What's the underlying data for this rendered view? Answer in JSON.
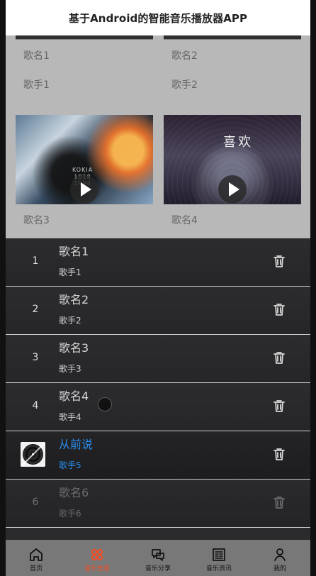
{
  "header": {
    "title": "基于Android的智能音乐播放器APP"
  },
  "grid": {
    "top_cards": [
      {
        "song": "歌名1",
        "singer": "歌手1"
      },
      {
        "song": "歌名2",
        "singer": "歌手2"
      }
    ],
    "bottom_cards": [
      {
        "song": "歌名3",
        "cover_text_lines": [
          "KOKIA",
          "1018",
          "1998"
        ]
      },
      {
        "song": "歌名4",
        "cover_text": "喜欢"
      }
    ]
  },
  "playlist": [
    {
      "index": "1",
      "title": "歌名1",
      "subtitle": "歌手1",
      "state": "normal"
    },
    {
      "index": "2",
      "title": "歌名2",
      "subtitle": "歌手2",
      "state": "normal"
    },
    {
      "index": "3",
      "title": "歌名3",
      "subtitle": "歌手3",
      "state": "normal"
    },
    {
      "index": "4",
      "title": "歌名4",
      "subtitle": "歌手4",
      "state": "normal"
    },
    {
      "index": "",
      "title": "从前说",
      "subtitle": "歌手5",
      "state": "active"
    },
    {
      "index": "6",
      "title": "歌名6",
      "subtitle": "歌手6",
      "state": "faded"
    }
  ],
  "bottom_nav": [
    {
      "label": "首页",
      "icon": "home-icon",
      "active": false
    },
    {
      "label": "音乐信息",
      "icon": "music-info-icon",
      "active": true
    },
    {
      "label": "音乐分享",
      "icon": "chat-bubbles-icon",
      "active": false
    },
    {
      "label": "音乐资讯",
      "icon": "news-icon",
      "active": false
    },
    {
      "label": "我的",
      "icon": "user-icon",
      "active": false
    }
  ],
  "colors": {
    "accent_blue": "#2a8ce8",
    "active_nav": "#ff4b1f",
    "header_bg": "#ffffff",
    "playlist_bg": "#2b2b2e"
  }
}
